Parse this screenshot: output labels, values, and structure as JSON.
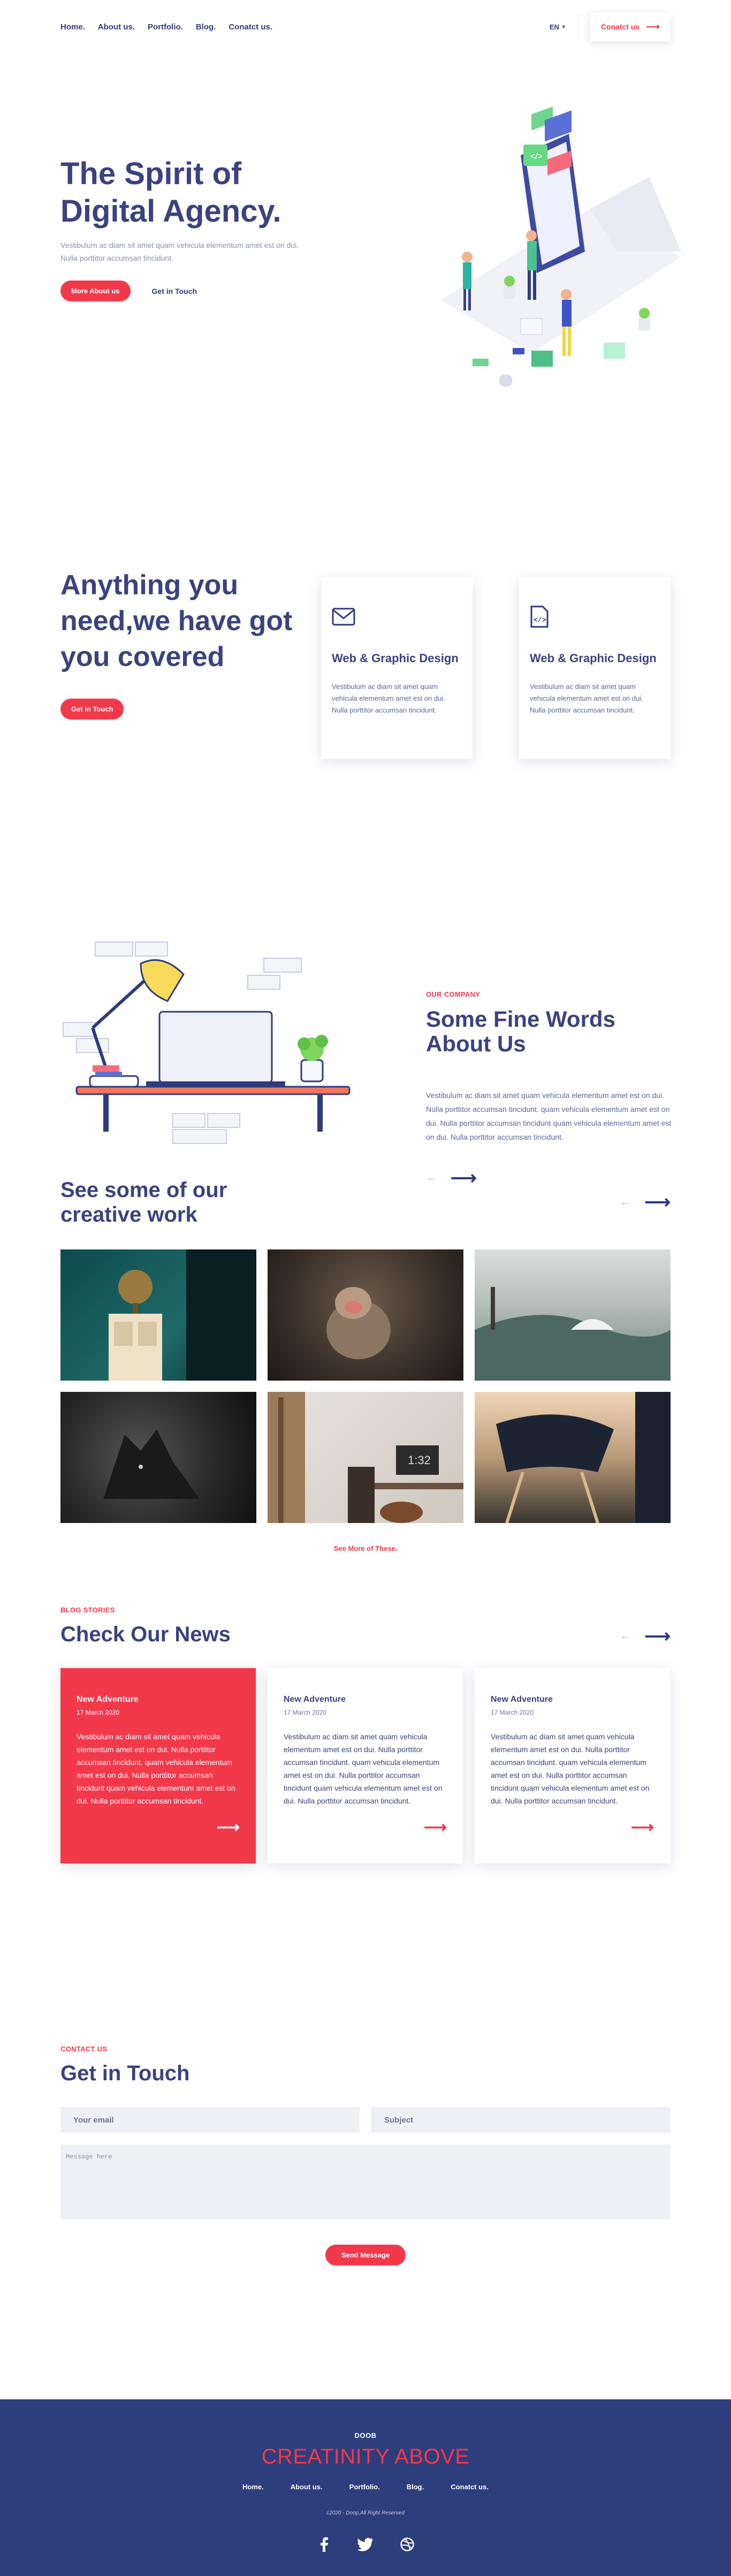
{
  "nav": {
    "links": [
      "Home.",
      "About us.",
      "Portfolio.",
      "Blog.",
      "Conatct us."
    ],
    "language": "EN",
    "contact_label": "Conatct us"
  },
  "hero": {
    "title": "The Spirit of Digital Agency.",
    "subtitle": "Vestibulum ac diam sit amet quam vehicula elementum amet est on dui. Nulla porttitor accumsan tincidunt.",
    "primary_button": "More About us",
    "secondary_link": "Get in Touch"
  },
  "services": {
    "title": "Anything you need,we have got you covered",
    "button": "Get in Touch",
    "cards": [
      {
        "icon": "mail-icon",
        "title": "Web & Graphic Design",
        "text": "Vestibulum ac diam sit amet quam vehicula elementum amet est on dui. Nulla porttitor accumsan tincidunt."
      },
      {
        "icon": "code-file-icon",
        "title": "Web & Graphic Design",
        "text": "Vestibulum ac diam sit amet quam vehicula elementum amet est on dui. Nulla porttitor accumsan tincidunt."
      }
    ]
  },
  "about": {
    "kicker": "OUR COMPANY",
    "title": "Some Fine Words About Us",
    "text": "Vestibulum ac diam sit amet quam vehicula elementum amet est on dui. Nulla porttitor accumsan tincidunt. quam vehicula elementum amet est on dui. Nulla porttitor accumsan tincidunt quam vehicula elementum amet est on dui. Nulla porttitor accumsan tincidunt."
  },
  "portfolio": {
    "title": "See some of our creative work",
    "see_more": "See More of These.",
    "tiles": [
      "globe-on-cabinet",
      "monkey-in-water",
      "surfers-on-waves",
      "black-wolf",
      "home-office-desk",
      "dark-chairs"
    ]
  },
  "news": {
    "kicker": "BLOG STORIES",
    "title": "Check Our News",
    "cards": [
      {
        "title": "New Adventure",
        "date": "17 March 2020",
        "text": "Vestibulum ac diam sit amet quam vehicula elementum amet est on dui. Nulla porttitor accumsan tincidunt. quam vehicula elementum amet est on dui. Nulla porttitor accumsan tincidunt quam vehicula elementum amet est on dui. Nulla porttitor accumsan tincidunt.",
        "active": true
      },
      {
        "title": "New Adventure",
        "date": "17 March 2020",
        "text": "Vestibulum ac diam sit amet quam vehicula elementum amet est on dui. Nulla porttitor accumsan tincidunt. quam vehicula elementum amet est on dui. Nulla porttitor accumsan tincidunt quam vehicula elementum amet est on dui. Nulla porttitor accumsan tincidunt.",
        "active": false
      },
      {
        "title": "New Adventure",
        "date": "17 March 2020",
        "text": "Vestibulum ac diam sit amet quam vehicula elementum amet est on dui. Nulla porttitor accumsan tincidunt. quam vehicula elementum amet est on dui. Nulla porttitor accumsan tincidunt quam vehicula elementum amet est on dui. Nulla porttitor accumsan tincidunt.",
        "active": false
      }
    ]
  },
  "contact": {
    "kicker": "CONTACT US",
    "title": "Get in Touch",
    "email_placeholder": "Your email",
    "subject_placeholder": "Subject",
    "message_placeholder": "Message here",
    "send_label": "Send Message"
  },
  "footer": {
    "brand": "DOOB",
    "tagline": "CREATINITY ABOVE",
    "links": [
      "Home.",
      "About us.",
      "Portfolio.",
      "Blog.",
      "Conatct us."
    ],
    "copyright": "c2020 - Doop,All Right Reserved",
    "social": [
      "facebook-icon",
      "twitter-icon",
      "dribbble-icon"
    ]
  },
  "colors": {
    "accent": "#f1394b",
    "navy": "#3a4280",
    "footer_bg": "#2e3d7c"
  }
}
